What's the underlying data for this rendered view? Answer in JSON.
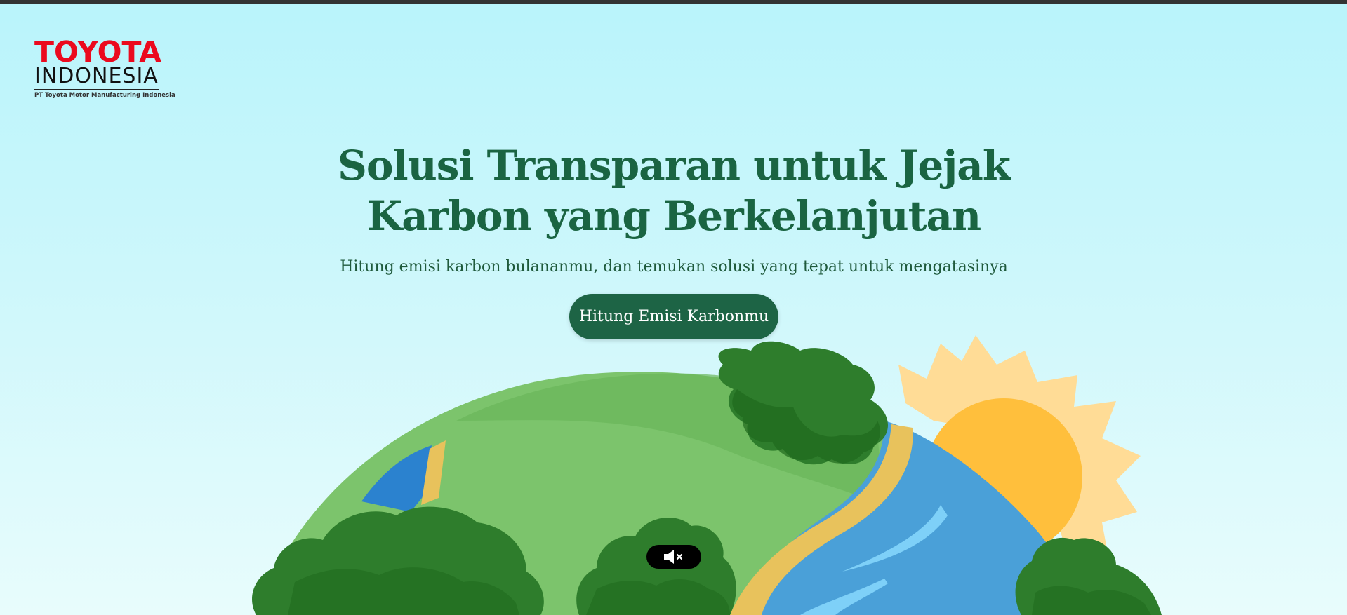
{
  "header": {
    "logo": {
      "brand": "TOYOTA",
      "country": "INDONESIA",
      "company": "PT  Toyota Motor Manufacturing Indonesia",
      "brand_color": "#eb0a1e"
    }
  },
  "hero": {
    "title_line1": "Solusi Transparan untuk Jejak",
    "title_line2": "Karbon yang Berkelanjutan",
    "subtitle": "Hitung emisi karbon bulananmu, dan temukan solusi yang tepat untuk mengatasinya",
    "cta_label": "Hitung Emisi Karbonmu"
  },
  "illustration": {
    "elements": [
      "globe",
      "trees",
      "river",
      "sun"
    ]
  },
  "audio": {
    "icon": "speaker-muted-icon"
  },
  "colors": {
    "title": "#1a6442",
    "button_bg": "#1d6445",
    "background_top": "#b9f4fb",
    "background_bottom": "#e8fcfc"
  }
}
